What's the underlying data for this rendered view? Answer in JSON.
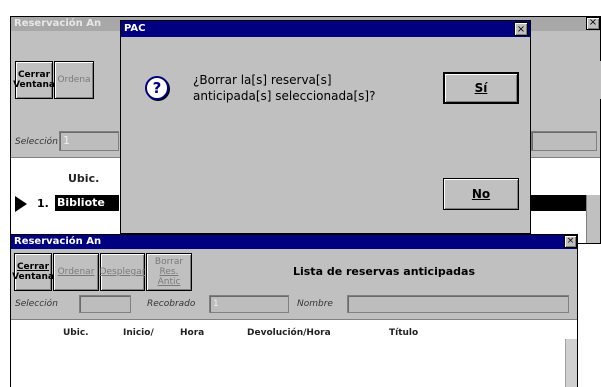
{
  "back_window": {
    "title": "Reservación An",
    "close_glyph": "×",
    "buttons": {
      "close_line1": "Cerrar",
      "close_line2": "Ventana",
      "order": "Ordena"
    },
    "selection_label": "Selección",
    "selection_value": "1",
    "column_ubic": "Ubic.",
    "row_number": "1.",
    "row_text": "Bibliote"
  },
  "dialog": {
    "title": "PAC",
    "close_glyph": "×",
    "icon": "question-mark-icon",
    "icon_glyph": "?",
    "message_line1": "¿Borrar la[s] reserva[s]",
    "message_line2": "anticipada[s] seleccionada[s]?",
    "yes_label": "Sí",
    "no_label": "No"
  },
  "front_window": {
    "title": "Reservación An",
    "close_glyph": "×",
    "toolbar": {
      "close_line1": "Cerrar",
      "close_line2": "Ventana",
      "order": "Ordenar",
      "expand": "Desplegar",
      "delete_line1": "Borrar",
      "delete_line2": "Res. Antic"
    },
    "list_title": "Lista de reservas anticipadas",
    "filters": {
      "selection_label": "Selección",
      "collected_label": "Recobrado",
      "collected_value": "1",
      "name_label": "Nombre"
    },
    "columns": [
      "Ubic.",
      "Inicio/",
      "Hora",
      "Devolución/Hora",
      "Título"
    ]
  },
  "colors": {
    "window_face": "#c0c0c0",
    "active_title": "#000080",
    "inactive_title": "#a8a8a8"
  }
}
